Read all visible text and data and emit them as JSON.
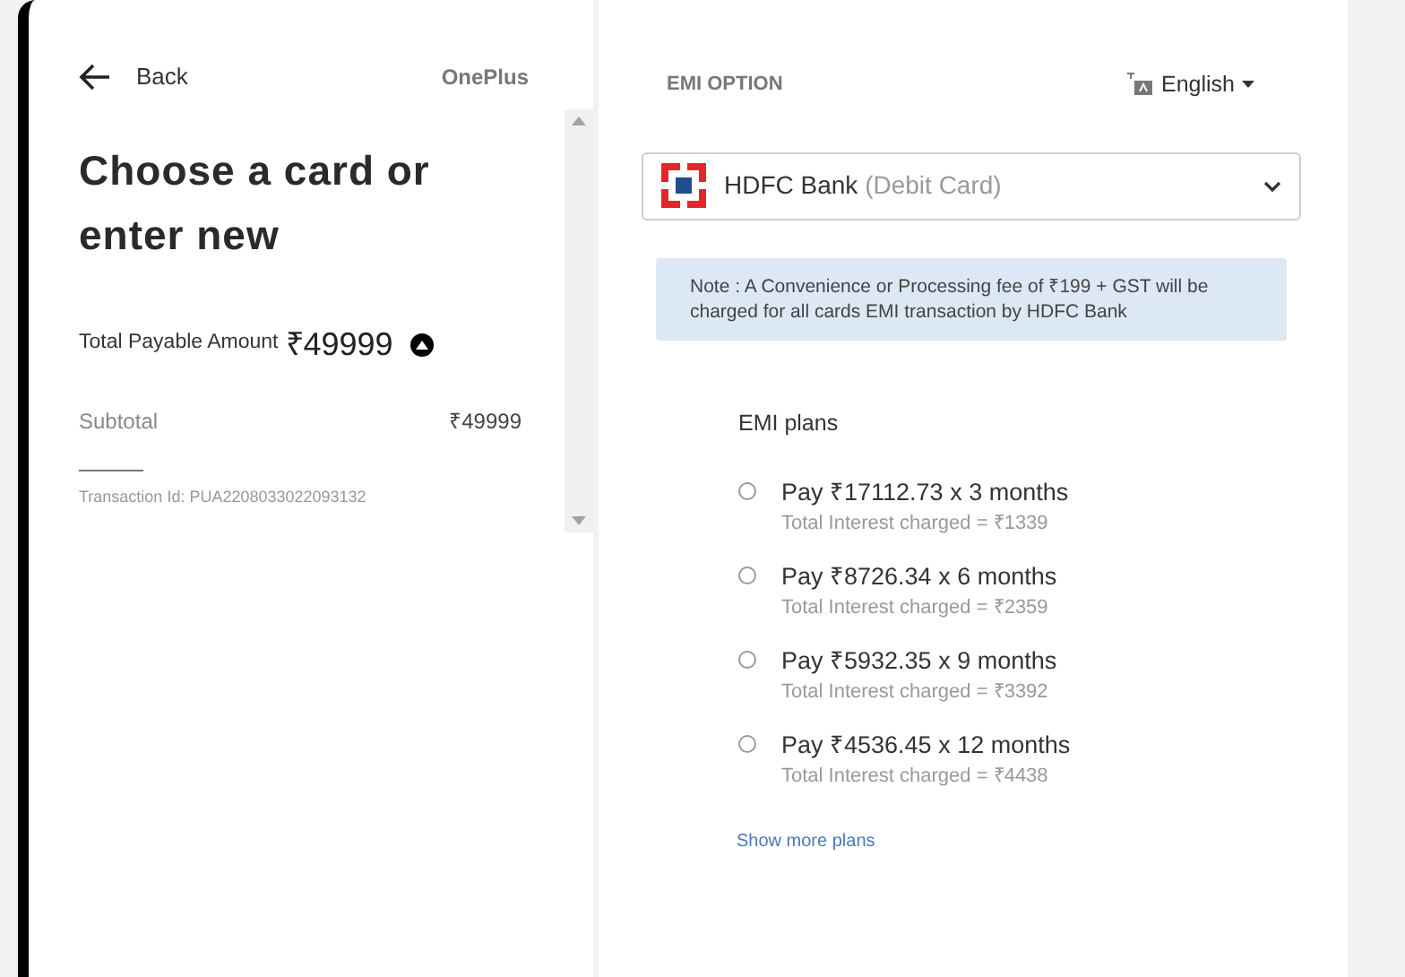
{
  "left": {
    "back": "Back",
    "brand": "OnePlus",
    "heading": "Choose a card or enter new",
    "total_label": "Total Payable Amount",
    "total_value": "₹49999",
    "expanded": true,
    "subtotal_label": "Subtotal",
    "subtotal_value": "₹49999",
    "transaction": "Transaction Id: PUA2208033022093132"
  },
  "right": {
    "section": "EMI OPTION",
    "language": "English",
    "bank": {
      "name": "HDFC Bank",
      "card_type": "(Debit Card)"
    },
    "note": "Note : A Convenience or Processing fee of ₹199 + GST will be charged for all cards EMI transaction by HDFC Bank",
    "plans_title": "EMI plans",
    "plans": [
      {
        "label": "Pay ₹17112.73 x 3 months",
        "interest": "Total Interest charged = ₹1339",
        "selected": false
      },
      {
        "label": "Pay ₹8726.34 x 6 months",
        "interest": "Total Interest charged = ₹2359",
        "selected": false
      },
      {
        "label": "Pay ₹5932.35 x 9 months",
        "interest": "Total Interest charged = ₹3392",
        "selected": false
      },
      {
        "label": "Pay ₹4536.45 x 12 months",
        "interest": "Total Interest charged = ₹4438",
        "selected": false
      }
    ],
    "more": "Show more plans"
  }
}
